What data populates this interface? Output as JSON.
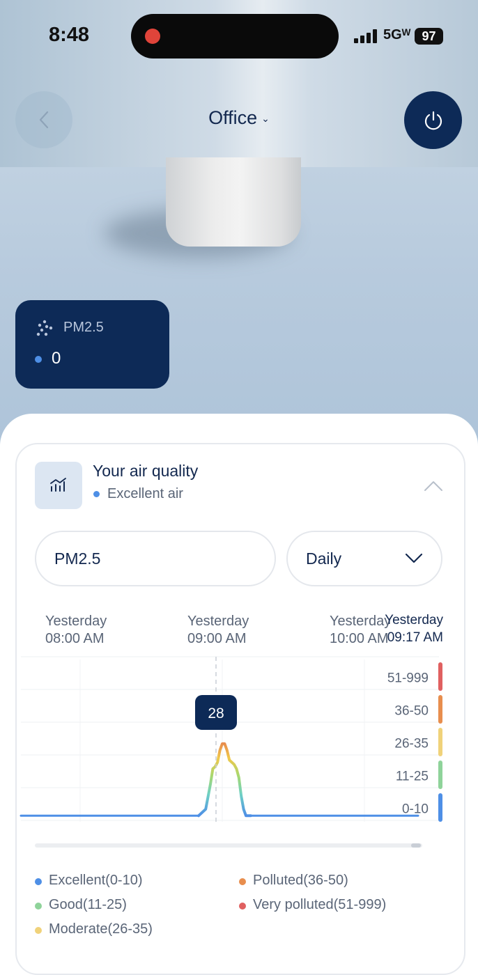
{
  "status_bar": {
    "time": "8:48",
    "network": "5Gᵂ",
    "battery": "97"
  },
  "nav": {
    "title": "Office"
  },
  "sensor_card": {
    "label": "PM2.5",
    "value": "0"
  },
  "air_quality": {
    "title": "Your air quality",
    "status": "Excellent air"
  },
  "filters": {
    "metric": "PM2.5",
    "period": "Daily"
  },
  "timeline": {
    "labels": [
      {
        "day": "Yesterday",
        "time": "08:00 AM"
      },
      {
        "day": "Yesterday",
        "time": "09:00 AM"
      },
      {
        "day": "Yesterday",
        "time": "10:00 AM"
      }
    ],
    "current": {
      "day": "Yesterday",
      "time": "09:17 AM"
    }
  },
  "chart_data": {
    "type": "area",
    "title": "",
    "xlabel": "",
    "ylabel": "",
    "y_bands": [
      {
        "label": "0-10",
        "color": "#4e8fe6"
      },
      {
        "label": "11-25",
        "color": "#8fd39a"
      },
      {
        "label": "26-35",
        "color": "#f0d27a"
      },
      {
        "label": "36-50",
        "color": "#e88e4e"
      },
      {
        "label": "51-999",
        "color": "#e06060"
      }
    ],
    "x_start": "08:00 AM",
    "x_end": "10:00 AM",
    "series": [
      {
        "x_minutes": [
          -115,
          -120,
          0,
          50,
          53,
          55,
          56,
          57,
          58,
          59,
          60,
          61,
          62,
          63,
          64,
          65,
          66,
          67,
          68,
          69,
          70,
          72,
          75,
          230
        ],
        "values": [
          1,
          1,
          1,
          1,
          3,
          11,
          18,
          19,
          21,
          26,
          28,
          28,
          26,
          22,
          21,
          20,
          18,
          14,
          7,
          3,
          1,
          1,
          1,
          1
        ]
      }
    ],
    "tooltip": "28",
    "grid": true
  },
  "legend": [
    {
      "label": "Excellent(0-10)",
      "color": "#4e8fe6"
    },
    {
      "label": "Good(11-25)",
      "color": "#8fd39a"
    },
    {
      "label": "Moderate(26-35)",
      "color": "#f0d27a"
    },
    {
      "label": "Polluted(36-50)",
      "color": "#e88e4e"
    },
    {
      "label": "Very polluted(51-999)",
      "color": "#e06060"
    }
  ]
}
